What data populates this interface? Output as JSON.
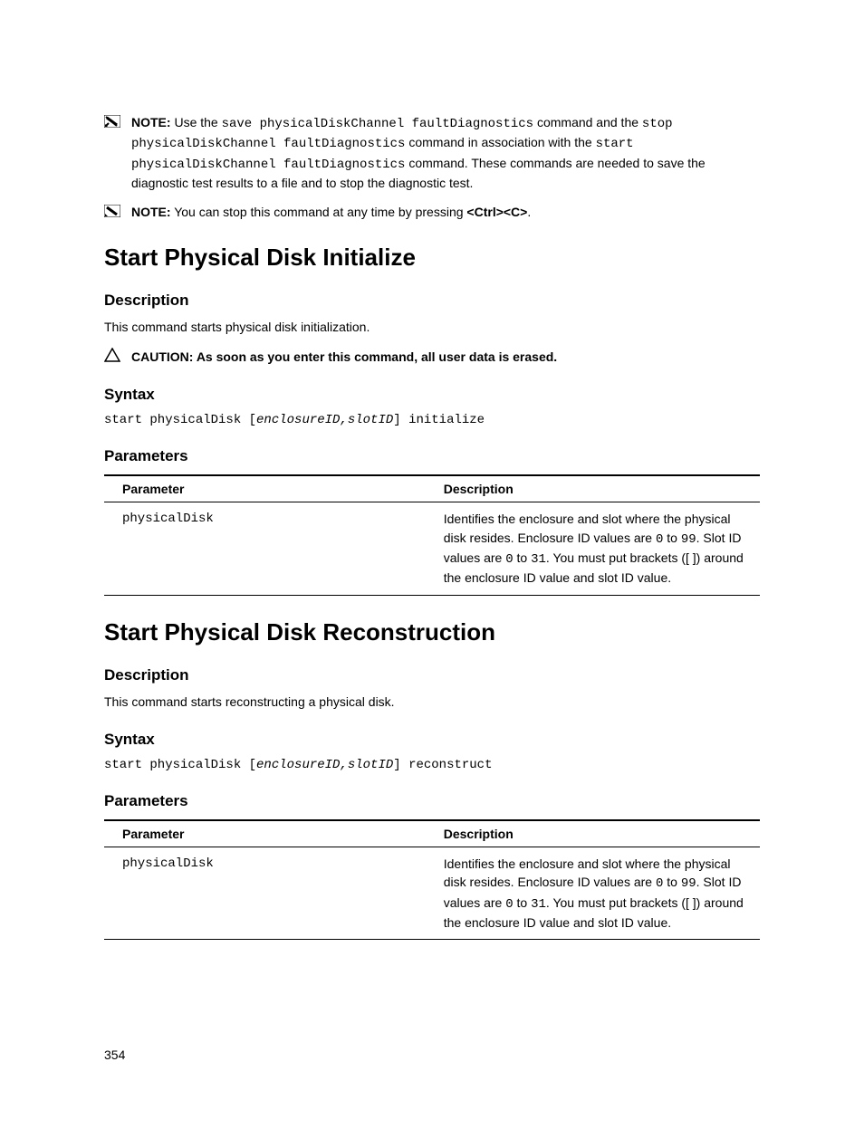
{
  "note1": {
    "label": "NOTE:",
    "t1": " Use the ",
    "c1": "save physicalDiskChannel faultDiagnostics",
    "t2": " command and the ",
    "c2": "stop physicalDiskChannel faultDiagnostics",
    "t3": " command in association with the ",
    "c3": "start physicalDiskChannel faultDiagnostics",
    "t4": " command. These commands are needed to save the diagnostic test results to a file and to stop the diagnostic test."
  },
  "note2": {
    "label": "NOTE:",
    "t1": " You can stop this command at any time by pressing ",
    "bold1": "<Ctrl><C>",
    "t2": "."
  },
  "section1": {
    "title": "Start Physical Disk Initialize",
    "description_h": "Description",
    "description_t": "This command starts physical disk initialization.",
    "caution_label": "CAUTION: ",
    "caution_text": "As soon as you enter this command, all user data is erased.",
    "syntax_h": "Syntax",
    "syntax_pre": "start physicalDisk [",
    "syntax_italic": "enclosureID,slotID",
    "syntax_post": "] initialize",
    "params_h": "Parameters",
    "th_param": "Parameter",
    "th_desc": "Description",
    "row_param": "physicalDisk",
    "row_desc_a": "Identifies the enclosure and slot where the physical disk resides. Enclosure ID values are ",
    "row_desc_c1": "0",
    "row_desc_b": " to ",
    "row_desc_c2": "99",
    "row_desc_c": ". Slot ID values are ",
    "row_desc_c3": "0",
    "row_desc_d": " to ",
    "row_desc_c4": "31",
    "row_desc_e": ". You must put brackets ([ ]) around the enclosure ID value and slot ID value."
  },
  "section2": {
    "title": "Start Physical Disk Reconstruction",
    "description_h": "Description",
    "description_t": "This command starts reconstructing a physical disk.",
    "syntax_h": "Syntax",
    "syntax_pre": "start physicalDisk [",
    "syntax_italic": "enclosureID,slotID",
    "syntax_post": "] reconstruct",
    "params_h": "Parameters",
    "th_param": "Parameter",
    "th_desc": "Description",
    "row_param": "physicalDisk",
    "row_desc_a": "Identifies the enclosure and slot where the physical disk resides. Enclosure ID values are ",
    "row_desc_c1": "0",
    "row_desc_b": " to ",
    "row_desc_c2": "99",
    "row_desc_c": ". Slot ID values are ",
    "row_desc_c3": "0",
    "row_desc_d": " to ",
    "row_desc_c4": "31",
    "row_desc_e": ". You must put brackets ([ ]) around the enclosure ID value and slot ID value."
  },
  "page_number": "354"
}
